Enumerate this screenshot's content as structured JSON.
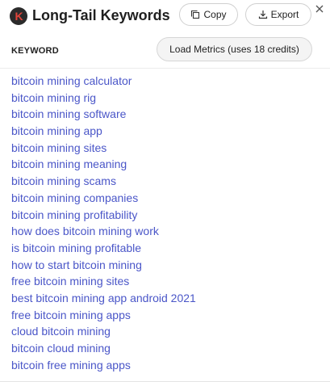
{
  "header": {
    "logo_letter": "K",
    "title": "Long-Tail Keywords",
    "copy_label": "Copy",
    "export_label": "Export",
    "close_symbol": "×"
  },
  "table": {
    "column_header": "KEYWORD",
    "load_metrics_label": "Load Metrics (uses 18 credits)"
  },
  "keywords": [
    "bitcoin mining calculator",
    "bitcoin mining rig",
    "bitcoin mining software",
    "bitcoin mining app",
    "bitcoin mining sites",
    "bitcoin mining meaning",
    "bitcoin mining scams",
    "bitcoin mining companies",
    "bitcoin mining profitability",
    "how does bitcoin mining work",
    "is bitcoin mining profitable",
    "how to start bitcoin mining",
    "free bitcoin mining sites",
    "best bitcoin mining app android 2021",
    "free bitcoin mining apps",
    "cloud bitcoin mining",
    "bitcoin cloud mining",
    "bitcoin free mining apps"
  ],
  "colors": {
    "keyword_link": "#4a56c8",
    "logo_bg": "#2b2b2b",
    "logo_letter": "#e0443a"
  },
  "icons": {
    "logo": "keywords-everywhere-logo",
    "copy": "copy-icon",
    "export": "download-icon",
    "close": "close-icon"
  }
}
